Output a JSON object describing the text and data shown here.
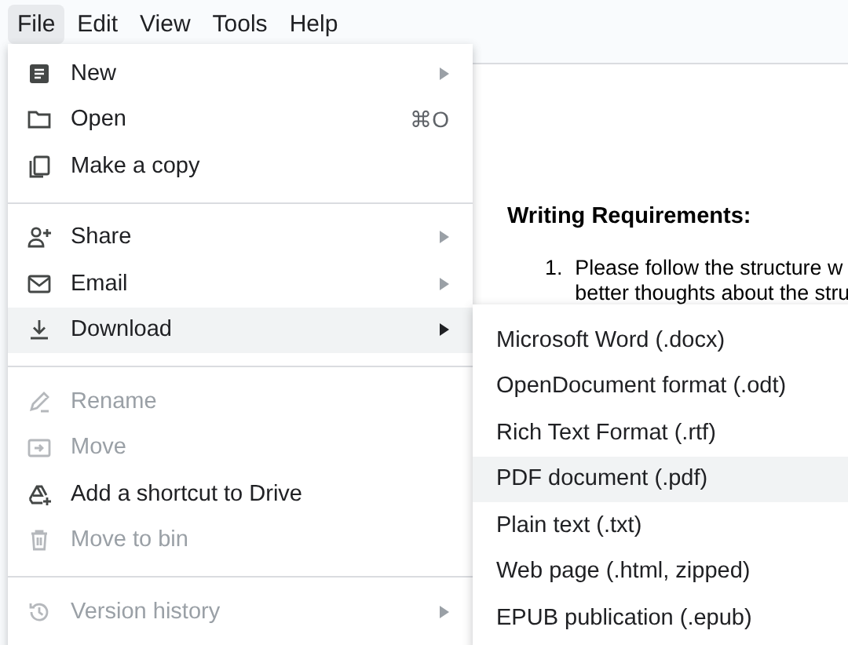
{
  "menubar": [
    {
      "label": "File",
      "selected": true
    },
    {
      "label": "Edit",
      "selected": false
    },
    {
      "label": "View",
      "selected": false
    },
    {
      "label": "Tools",
      "selected": false
    },
    {
      "label": "Help",
      "selected": false
    }
  ],
  "document": {
    "heading": "Writing Requirements:",
    "list": [
      {
        "number": "1.",
        "lines": [
          "Please follow the structure w",
          "better thoughts about the stru"
        ]
      }
    ]
  },
  "file_menu": {
    "items": [
      {
        "kind": "item",
        "label": "New",
        "has_submenu": true,
        "disabled": false,
        "selected": false
      },
      {
        "kind": "item",
        "label": "Open",
        "shortcut": "⌘O",
        "disabled": false,
        "selected": false
      },
      {
        "kind": "item",
        "label": "Make a copy",
        "disabled": false,
        "selected": false
      },
      {
        "kind": "divider"
      },
      {
        "kind": "item",
        "label": "Share",
        "has_submenu": true,
        "disabled": false,
        "selected": false
      },
      {
        "kind": "item",
        "label": "Email",
        "has_submenu": true,
        "disabled": false,
        "selected": false
      },
      {
        "kind": "item",
        "label": "Download",
        "has_submenu": true,
        "disabled": false,
        "selected": true
      },
      {
        "kind": "divider"
      },
      {
        "kind": "item",
        "label": "Rename",
        "disabled": true,
        "selected": false
      },
      {
        "kind": "item",
        "label": "Move",
        "disabled": true,
        "selected": false
      },
      {
        "kind": "item",
        "label": "Add a shortcut to Drive",
        "disabled": false,
        "selected": false
      },
      {
        "kind": "item",
        "label": "Move to bin",
        "disabled": true,
        "selected": false
      },
      {
        "kind": "divider"
      },
      {
        "kind": "item",
        "label": "Version history",
        "has_submenu": true,
        "disabled": true,
        "selected": false
      }
    ]
  },
  "download_menu": {
    "items": [
      {
        "label": "Microsoft Word (.docx)",
        "selected": false
      },
      {
        "label": "OpenDocument format (.odt)",
        "selected": false
      },
      {
        "label": "Rich Text Format (.rtf)",
        "selected": false
      },
      {
        "label": "PDF document (.pdf)",
        "selected": true
      },
      {
        "label": "Plain text (.txt)",
        "selected": false
      },
      {
        "label": "Web page (.html, zipped)",
        "selected": false
      },
      {
        "label": "EPUB publication (.epub)",
        "selected": false
      }
    ]
  }
}
